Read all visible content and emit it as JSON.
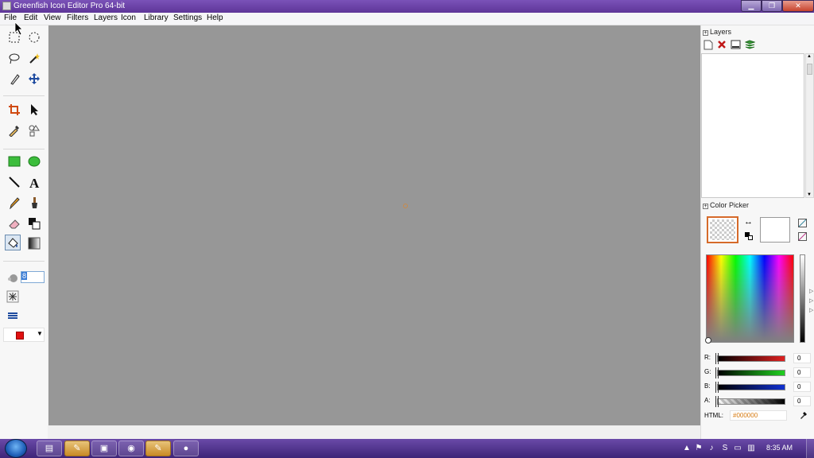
{
  "window": {
    "title": "Greenfish Icon Editor Pro 64-bit",
    "minimize_glyph": "▁",
    "maximize_glyph": "❐",
    "close_glyph": "✕"
  },
  "menu": {
    "items": [
      "File",
      "Edit",
      "View",
      "Filters",
      "Layers",
      "Icon",
      "Library",
      "Settings",
      "Help"
    ]
  },
  "toolbox": {
    "brush_size": "8",
    "selected_tool": "fill-tool",
    "foreground_color": "#e01010",
    "dropdown_glyph": "▼"
  },
  "canvas": {
    "background": "#979797"
  },
  "layers_panel": {
    "title": "Layers",
    "expand_glyph": "+"
  },
  "color_picker": {
    "title": "Color Picker",
    "expand_glyph": "+",
    "swap_glyph": "↔",
    "primary_color_label": "",
    "channels": [
      {
        "label": "R:",
        "value": "0",
        "color": "#e02020"
      },
      {
        "label": "G:",
        "value": "0",
        "color": "#20d020"
      },
      {
        "label": "B:",
        "value": "0",
        "color": "#1030d0"
      },
      {
        "label": "A:",
        "value": "0",
        "color": "#000000"
      }
    ],
    "html_label": "HTML:",
    "html_value": "#000000",
    "accent_color": "#d66a2a"
  },
  "taskbar": {
    "apps": [
      "explorer-icon",
      "paint-icon",
      "media-icon",
      "chrome-icon",
      "greenfish-icon",
      "recorder-icon"
    ],
    "time": "8:35 AM"
  }
}
